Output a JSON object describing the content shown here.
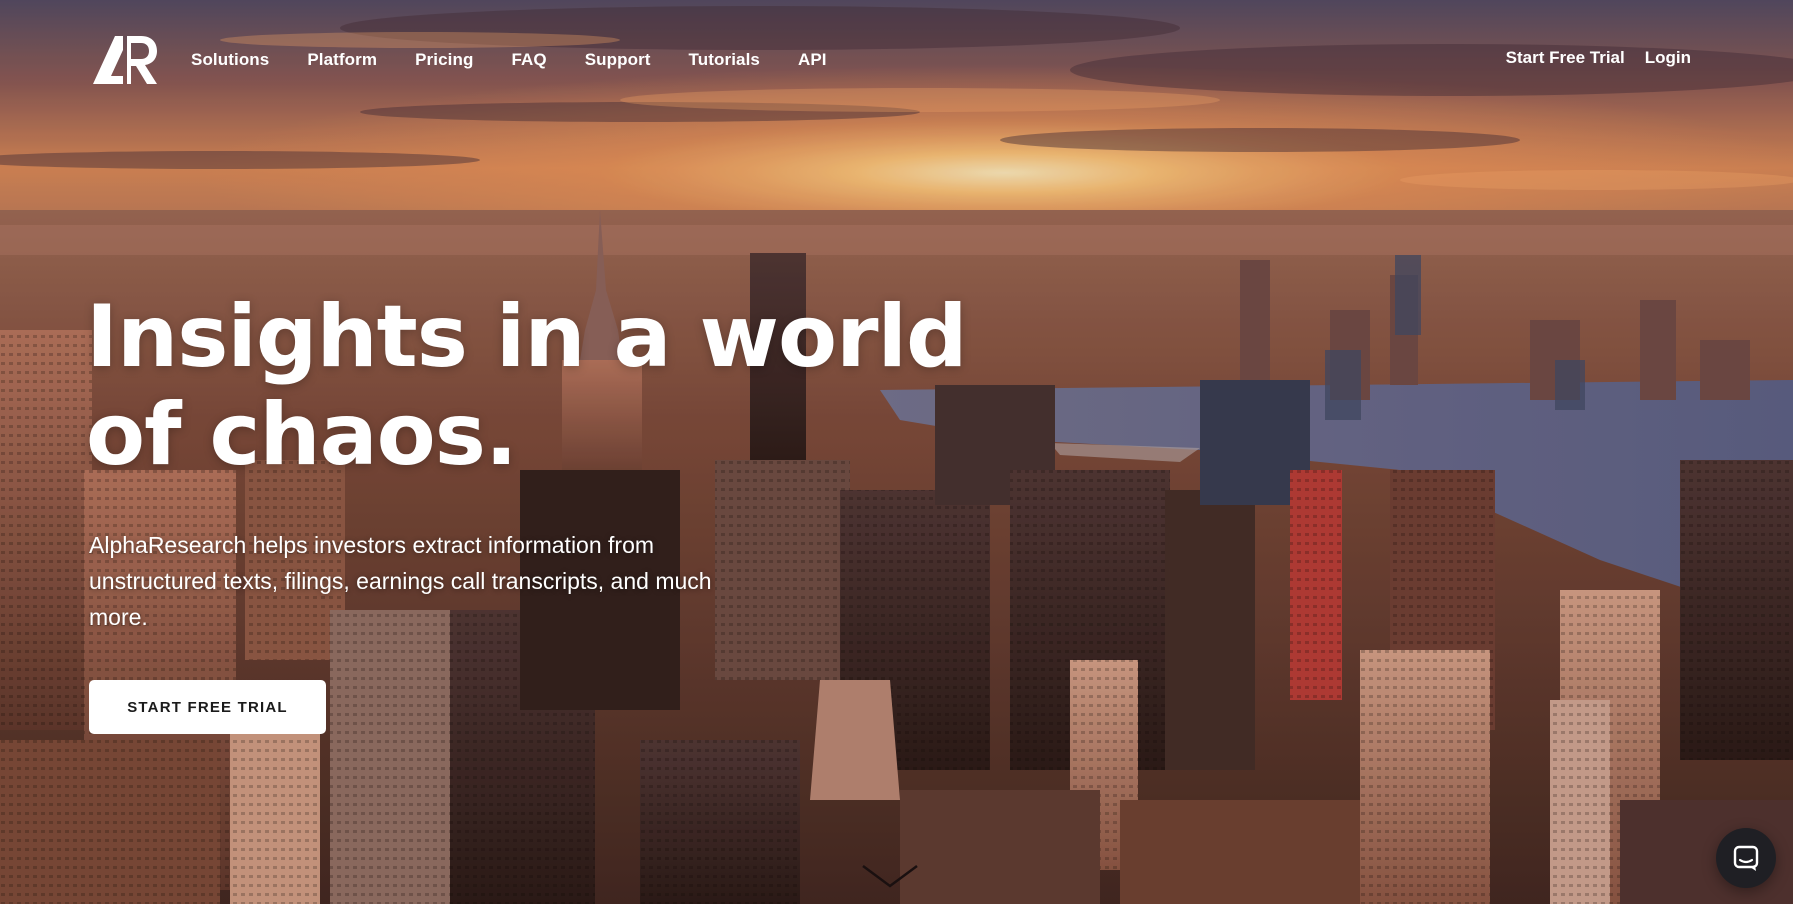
{
  "brand": {
    "logo_text": "AR",
    "icon": "ar-logo-icon"
  },
  "nav": {
    "items": [
      {
        "label": "Solutions"
      },
      {
        "label": "Platform"
      },
      {
        "label": "Pricing"
      },
      {
        "label": "FAQ"
      },
      {
        "label": "Support"
      },
      {
        "label": "Tutorials"
      },
      {
        "label": "API"
      }
    ],
    "start_trial_label": "Start Free Trial",
    "login_label": "Login"
  },
  "hero": {
    "headline_line1": "Insights in a world",
    "headline_line2": "of chaos.",
    "description": "AlphaResearch helps investors extract information from unstructured texts, filings, earnings call transcripts, and much more.",
    "cta_label": "START FREE TRIAL",
    "background": "city-skyline-sunset-photo",
    "scroll_icon": "chevron-down-icon"
  },
  "chat": {
    "icon": "chat-bubble-icon"
  },
  "colors": {
    "text": "#ffffff",
    "cta_bg": "#ffffff",
    "cta_text": "#1b1b1b",
    "chat_bg": "#1f1f24",
    "sky_top": "#4e4b6a",
    "sunset": "#ffd08a",
    "water": "#5f6a94"
  }
}
